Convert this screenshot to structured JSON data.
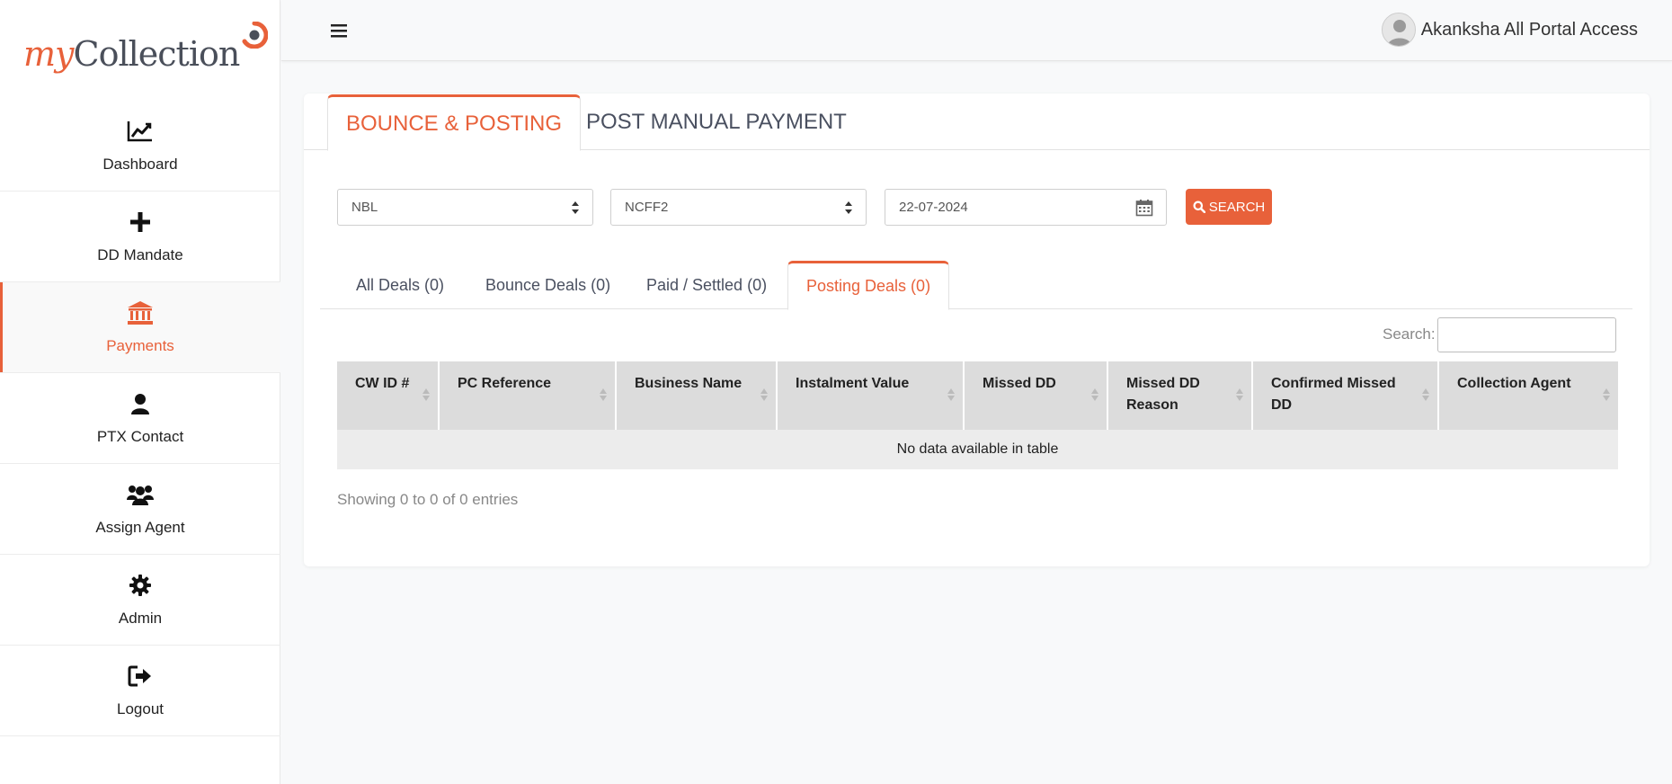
{
  "brand": {
    "part1": "my",
    "part2": "Collection"
  },
  "sidebar": {
    "items": [
      {
        "label": "Dashboard",
        "icon": "line-chart-icon"
      },
      {
        "label": "DD Mandate",
        "icon": "plus-icon"
      },
      {
        "label": "Payments",
        "icon": "bank-icon",
        "active": true
      },
      {
        "label": "PTX Contact",
        "icon": "user-icon"
      },
      {
        "label": "Assign Agent",
        "icon": "users-icon"
      },
      {
        "label": "Admin",
        "icon": "gear-icon"
      },
      {
        "label": "Logout",
        "icon": "sign-out-icon"
      }
    ]
  },
  "topbar": {
    "user_name": "Akanksha All Portal Access"
  },
  "main_tabs": [
    {
      "label": "BOUNCE & POSTING",
      "active": true
    },
    {
      "label": "POST MANUAL PAYMENT",
      "active": false
    }
  ],
  "filters": {
    "select1": "NBL",
    "select2": "NCFF2",
    "date": "22-07-2024",
    "search_label": "SEARCH"
  },
  "sub_tabs": [
    {
      "label": "All Deals (0)"
    },
    {
      "label": "Bounce Deals (0)"
    },
    {
      "label": "Paid / Settled (0)"
    },
    {
      "label": "Posting Deals (0)",
      "active": true
    }
  ],
  "table": {
    "search_label": "Search:",
    "columns": [
      "CW ID #",
      "PC Reference",
      "Business Name",
      "Instalment Value",
      "Missed DD",
      "Missed DD Reason",
      "Confirmed Missed DD",
      "Collection Agent"
    ],
    "empty_text": "No data available in table",
    "info": "Showing 0 to 0 of 0 entries"
  },
  "colors": {
    "accent": "#e8613a",
    "header_bg": "#dcdcdc",
    "row_bg": "#ececec"
  }
}
